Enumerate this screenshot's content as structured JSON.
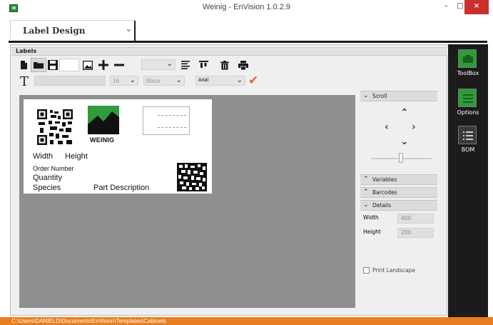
{
  "window": {
    "title": "Weinig - EnVision 1.0.2.9",
    "min_glyph": "–",
    "max_glyph": "□",
    "close_glyph": "×"
  },
  "module": {
    "selected": "Label Design"
  },
  "panel": {
    "title": "Labels"
  },
  "toolbar": {
    "size_value": "16",
    "color_value": "Black",
    "font_value": "Arial"
  },
  "label": {
    "logo_text": "WEINIG",
    "width": "Width",
    "height": "Height",
    "order_number": "Order Number",
    "quantity": "Quantity",
    "species": "Species",
    "part_description": "Part Description"
  },
  "side": {
    "scroll": "Scroll",
    "variables": "Variables",
    "barcodes": "Barcodes",
    "details": "Details",
    "width_label": "Width",
    "width_value": "400",
    "height_label": "Height",
    "height_value": "200",
    "print_landscape": "Print Landscape"
  },
  "tools": {
    "toolbox": "ToolBox",
    "options": "Options",
    "bom": "BOM"
  },
  "status": {
    "path": "C:\\Users\\DANIELD\\Documents\\EnVision\\Templates\\Cabinets"
  },
  "colors": {
    "accent_green": "#2e9c3a",
    "status_orange": "#e87e1f",
    "close_red": "#c9302c",
    "check_orange": "#f0593c"
  }
}
